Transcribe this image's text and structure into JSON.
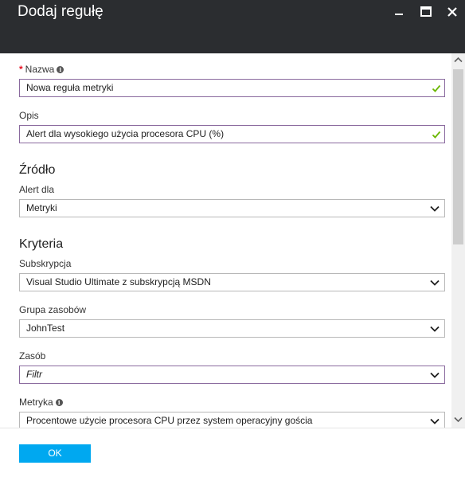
{
  "window": {
    "title": "Dodaj regułę"
  },
  "fields": {
    "name": {
      "label": "Nazwa",
      "value": "Nowa reguła metryki"
    },
    "description": {
      "label": "Opis",
      "value": "Alert dla wysokiego użycia procesora CPU (%)"
    },
    "source_section": "Źródło",
    "alert_for": {
      "label": "Alert dla",
      "value": "Metryki"
    },
    "criteria_section": "Kryteria",
    "subscription": {
      "label": "Subskrypcja",
      "value": "Visual Studio Ultimate z subskrypcją MSDN"
    },
    "resource_group": {
      "label": "Grupa zasobów",
      "value": "JohnTest"
    },
    "resource": {
      "label": "Zasób",
      "value": "Filtr"
    },
    "metric": {
      "label": "Metryka",
      "value": "Procentowe użycie procesora CPU przez system operacyjny gościa"
    }
  },
  "footer": {
    "ok_label": "OK"
  },
  "colors": {
    "titlebar": "#2b2d30",
    "accent": "#00a8f0",
    "check": "#6bb700",
    "required": "#e81123"
  }
}
